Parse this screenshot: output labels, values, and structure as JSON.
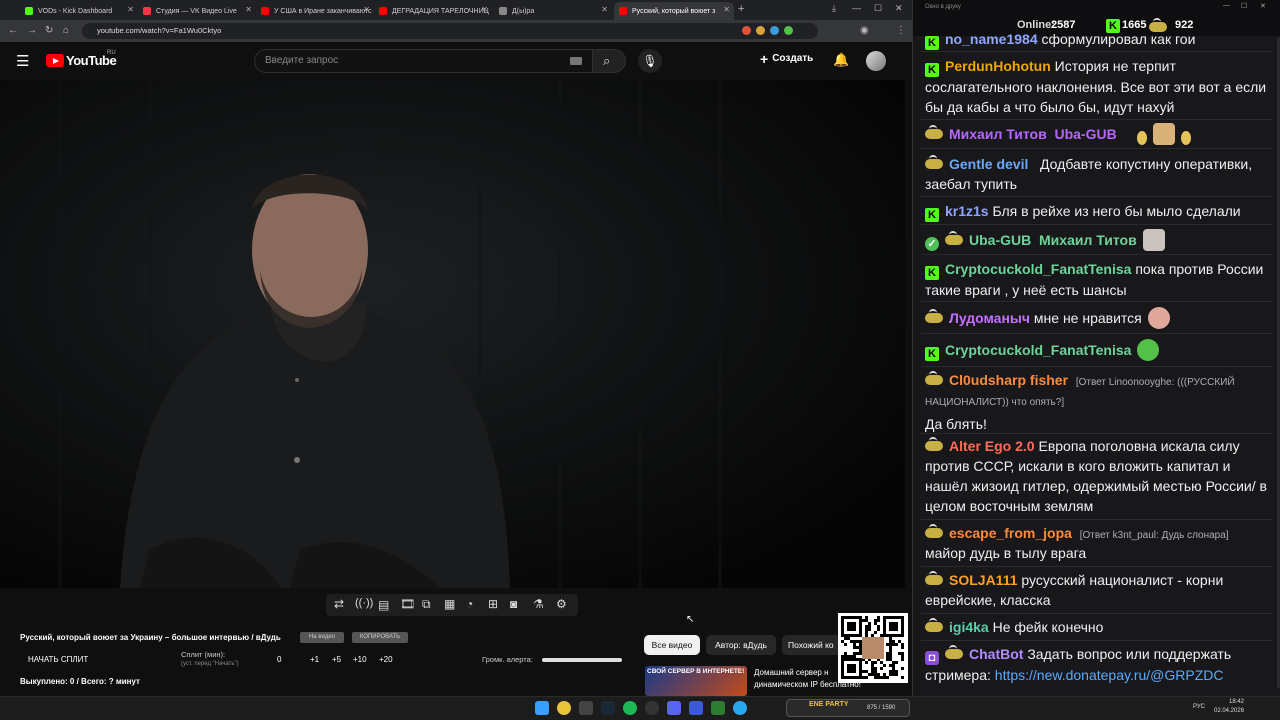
{
  "browser": {
    "tabs": [
      {
        "title": "VODs - Kick Dashboard",
        "color": "#53fc18"
      },
      {
        "title": "Студия — VK Видео Live",
        "color": "#ff3347"
      },
      {
        "title": "У США в Иране заканчиваютс",
        "color": "#ff0000"
      },
      {
        "title": "ДЕГРАДАЦИЯ ТАРЕЛОЧНИЦ",
        "color": "#ff0000"
      },
      {
        "title": "Д(ы)ра",
        "color": "#888888"
      },
      {
        "title": "Русский, который воюет з",
        "color": "#ff0000"
      }
    ],
    "url": "youtube.com/watch?v=Fa1Wu0Cktyo"
  },
  "youtube": {
    "logo_text": "YouTube",
    "region": "RU",
    "search_placeholder": "Введите запрос",
    "create_label": "Создать"
  },
  "controls": {
    "video_title": "Русский, который воюет за Украину – большое интервью / вДудь",
    "tag_on_video": "На видео",
    "tag_copy": "КОПИРОВАТЬ",
    "start_split": "НАЧАТЬ СПЛИТ",
    "split_label": "Сплит (мин):",
    "split_hint": "(уст. перед \"Начать\")",
    "split_value": "0",
    "split_steps": [
      "+1",
      "+5",
      "+10",
      "+20"
    ],
    "alert_volume_label": "Громк. алерта:",
    "bought": "Выкуплено: 0 / Всего: ? минут",
    "filter_all": "Все видео",
    "filter_author": "Автор: вДудь",
    "filter_similar": "Похожий ко",
    "promo_banner": "СВОЙ СЕРВЕР В ИНТЕРНЕТЕ!",
    "promo_text_1": "Домашний сервер н",
    "promo_text_2": "динамическом IP бесплатно!"
  },
  "chat": {
    "window_title": "Окно в друку",
    "online_label": "Online:",
    "online": "2587",
    "kick_count": "1665",
    "vk_count": "922",
    "messages": [
      {
        "name": "no_name1984",
        "color": "#8fa5ff",
        "text": "сформулировал как гои",
        "platform": "kick"
      },
      {
        "name": "PerdunHohotun",
        "color": "#f0a500",
        "text": "История не терпит сослагательного наклонения. Все вот эти вот а если бы да кабы а что было бы, идут нахуй",
        "platform": "kick"
      },
      {
        "name": "Михаил Титов",
        "name2": "Uba-GUB",
        "color": "#b666ff",
        "text": "",
        "platform": "vk"
      },
      {
        "name": "Gentle devil",
        "color": "#6aa8ff",
        "text": "Додбавте копустину оперативки, заебал тупить",
        "platform": "vk"
      },
      {
        "name": "kr1z1s",
        "color": "#8fa5ff",
        "text": "Бля в рейхе из него бы мыло сделали",
        "platform": "kick"
      },
      {
        "name": "Uba-GUB",
        "name2": "Михаил Титов",
        "color": "#6fd39a",
        "text": "",
        "platform": "vk"
      },
      {
        "name": "Cryptocuckold_FanatTenisa",
        "color": "#6fd39a",
        "text": "пока против России такие враги , у неё есть шансы",
        "platform": "kick"
      },
      {
        "name": "Лудоманыч",
        "color": "#c470ff",
        "text": "мне не нравится",
        "platform": "vk"
      },
      {
        "name": "Cryptocuckold_FanatTenisa",
        "color": "#6fd39a",
        "text": "",
        "platform": "kick"
      },
      {
        "name": "Cl0udsharp fisher",
        "color": "#ff8a3c",
        "reply": "[Ответ Linoonooyghe: (((РУССКИЙ НАЦИОНАЛИСТ)) что опять?]",
        "text": "Да блять!",
        "platform": "vk"
      },
      {
        "name": "Alter Ego 2.0",
        "color": "#ff6a5a",
        "text": "Европа поголовна искала силу против СССР, искали в кого вложить капитал и нашёл жизоид гитлер, одержимый местью России/ в целом восточным землям",
        "platform": "vk"
      },
      {
        "name": "escape_from_jopa",
        "color": "#ff8a3c",
        "reply": "[Ответ k3nt_paul: Дудь слонара]",
        "text": "майор дудь в тылу врага",
        "platform": "vk"
      },
      {
        "name": "SOLJA111",
        "color": "#ffa020",
        "text": "русусский националист - корни еврейские, класска",
        "platform": "vk"
      },
      {
        "name": "igi4ka",
        "color": "#56d0a8",
        "text": "Не фейк конечно",
        "platform": "vk"
      },
      {
        "name": "ChatBot",
        "color": "#b28bff",
        "text": "Задать вопрос или поддержать стримера: ",
        "link": "https://new.donatepay.ru/@GRPZDC",
        "platform": "bot"
      }
    ]
  },
  "taskbar": {
    "lang": "РУС",
    "time": "18:42",
    "date": "02.04.2026",
    "tray_widget": "ENE PARTY",
    "tray_count": "875 / 1590"
  },
  "colors": {
    "accent_red": "#ff0000",
    "kick_green": "#53fc18",
    "link": "#5aa9ff"
  }
}
